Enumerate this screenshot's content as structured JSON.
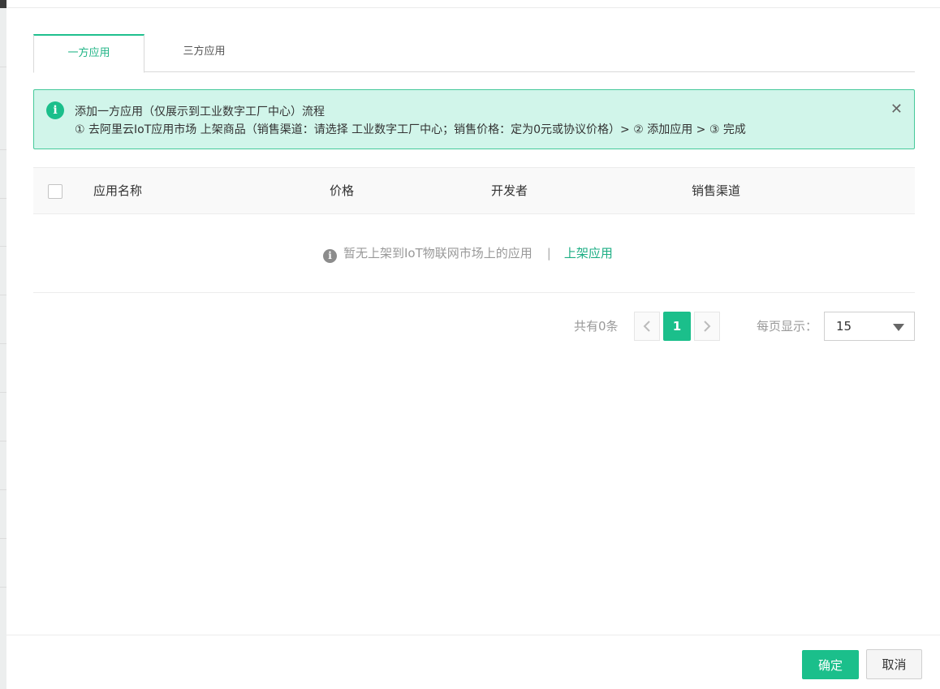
{
  "tabs": [
    {
      "label": "一方应用",
      "active": true
    },
    {
      "label": "三方应用",
      "active": false
    }
  ],
  "alert": {
    "icon": "info-icon",
    "title": "添加一方应用（仅展示到工业数字工厂中心）流程",
    "description": "① 去阿里云IoT应用市场 上架商品（销售渠道：请选择 工业数字工厂中心；销售价格：定为0元或协议价格）> ② 添加应用 > ③ 完成",
    "close_icon": "close-icon"
  },
  "table": {
    "columns": [
      "应用名称",
      "价格",
      "开发者",
      "销售渠道"
    ],
    "rows": [],
    "empty": {
      "message": "暂无上架到IoT物联网市场上的应用",
      "separator": "|",
      "link": "上架应用"
    }
  },
  "pagination": {
    "total_text": "共有0条",
    "current_page": "1",
    "per_page_label": "每页显示：",
    "per_page_value": "15"
  },
  "footer": {
    "confirm": "确定",
    "cancel": "取消"
  },
  "colors": {
    "accent": "#1bbf8b",
    "alert_bg": "#d1f5ea",
    "link": "#1dae84"
  }
}
